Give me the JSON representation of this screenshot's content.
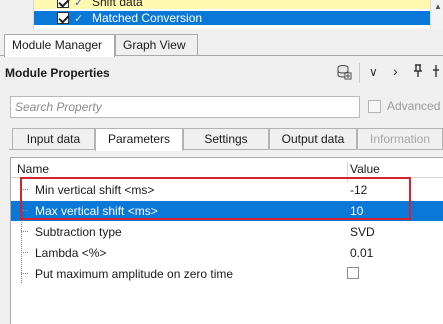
{
  "tree": {
    "rows": [
      {
        "label": "Shift data",
        "checked": true
      },
      {
        "label": "Matched Conversion",
        "checked": true,
        "selected": true
      }
    ]
  },
  "manager_tabs": [
    {
      "label": "Module Manager",
      "active": true
    },
    {
      "label": "Graph View",
      "active": false
    }
  ],
  "module_properties": {
    "title": "Module Properties",
    "toolbar": {
      "chevron": "∨",
      "next": "›",
      "pin": "📌",
      "more": "⫶"
    }
  },
  "search": {
    "placeholder": "Search Property",
    "value": ""
  },
  "advanced": {
    "label": "Advanced",
    "checked": false,
    "enabled": false
  },
  "property_tabs": [
    {
      "label": "Input data",
      "active": false,
      "enabled": true
    },
    {
      "label": "Parameters",
      "active": true,
      "enabled": true
    },
    {
      "label": "Settings",
      "active": false,
      "enabled": true
    },
    {
      "label": "Output data",
      "active": false,
      "enabled": true
    },
    {
      "label": "Information",
      "active": false,
      "enabled": false
    }
  ],
  "grid": {
    "columns": {
      "name": "Name",
      "value": "Value"
    },
    "rows": [
      {
        "name": "Min vertical shift <ms>",
        "value": "-12"
      },
      {
        "name": "Max vertical shift <ms>",
        "value": "10",
        "selected": true
      },
      {
        "name": "Subtraction type",
        "value": "SVD"
      },
      {
        "name": "Lambda <%>",
        "value": "0.01"
      },
      {
        "name": "Put maximum amplitude on zero time",
        "value": "",
        "checkbox": true,
        "checked": false
      }
    ]
  },
  "colors": {
    "selection": "#0a78d7",
    "annotation_box": "#d4232c",
    "tree_highlight": "#fff9b0"
  }
}
